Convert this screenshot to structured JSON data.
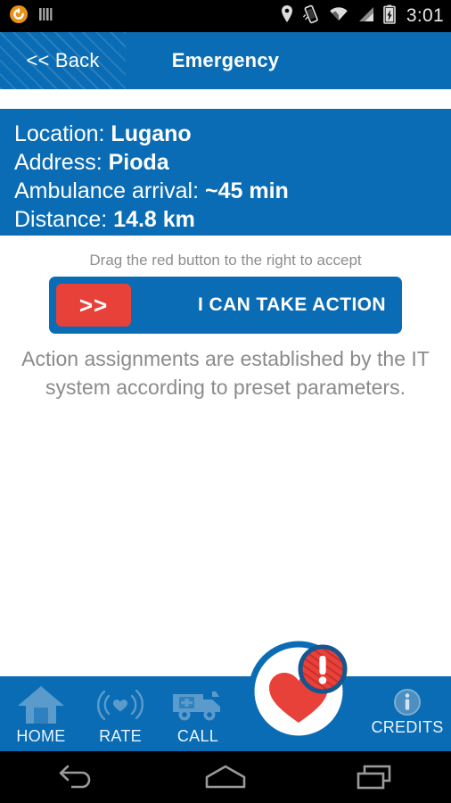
{
  "status_bar": {
    "time": "3:01",
    "left_icons": [
      "app-circle-icon",
      "barcode-icon"
    ],
    "right_icons": [
      "location-pin-icon",
      "vibrate-icon",
      "wifi-icon",
      "signal-icon",
      "battery-charging-icon"
    ]
  },
  "header": {
    "back_label": "<< Back",
    "title": "Emergency"
  },
  "info": {
    "rows": [
      {
        "label": "Location:",
        "value": "Lugano"
      },
      {
        "label": "Address:",
        "value": "Pioda"
      },
      {
        "label": "Ambulance arrival:",
        "value": "~45 min"
      },
      {
        "label": "Distance:",
        "value": "14.8 km"
      }
    ]
  },
  "action": {
    "hint": "Drag the red button to the right to accept",
    "handle_label": ">>",
    "slider_label": "I CAN TAKE ACTION",
    "note": "Action assignments are established by the IT system according to preset parameters."
  },
  "bottom_nav": {
    "items": [
      {
        "label": "HOME",
        "icon": "house-icon"
      },
      {
        "label": "RATE",
        "icon": "heart-waves-icon"
      },
      {
        "label": "CALL",
        "icon": "ambulance-icon"
      },
      {
        "label": "CREDITS",
        "icon": "info-circle-icon"
      }
    ]
  },
  "logo": {
    "name": "heart-alert-logo"
  },
  "android_nav": {
    "buttons": [
      "back-nav-icon",
      "home-nav-icon",
      "recents-nav-icon"
    ]
  },
  "colors": {
    "brand_blue": "#0a6cb4",
    "alert_red": "#e8413a",
    "nav_icon_blue": "#5b9bcb",
    "muted_text": "#8b8b8b"
  }
}
